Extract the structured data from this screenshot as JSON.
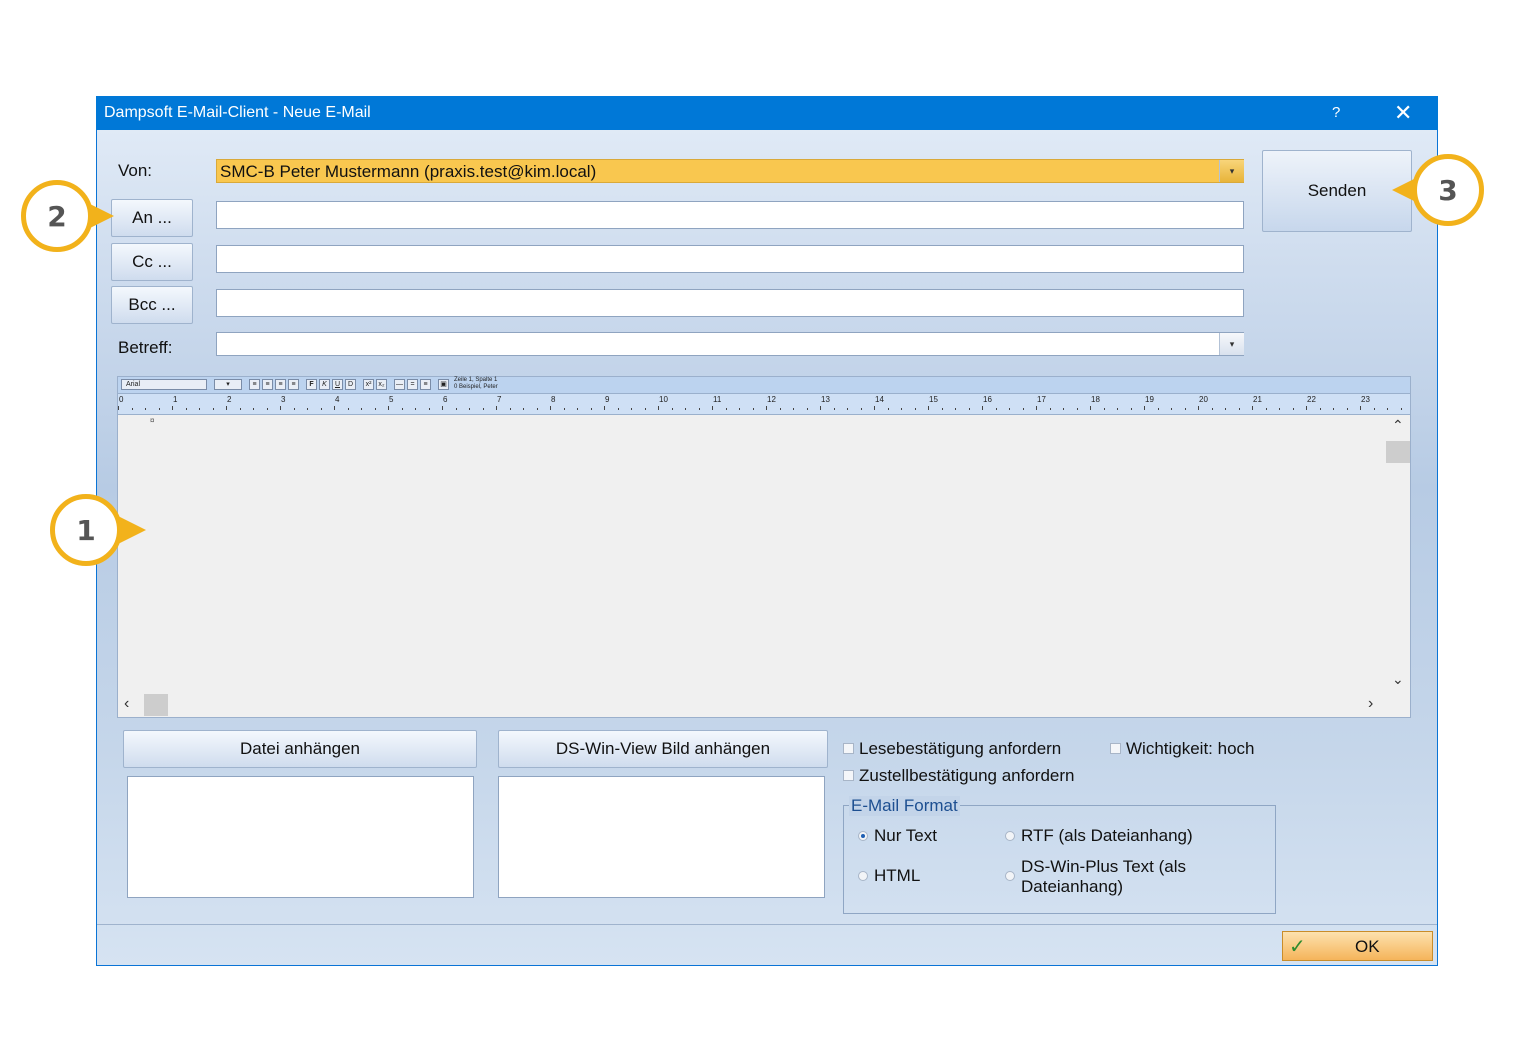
{
  "window": {
    "title": "Dampsoft E-Mail-Client - Neue E-Mail",
    "help": "?",
    "close": "✕"
  },
  "form": {
    "von_label": "Von:",
    "von_value": "SMC-B Peter Mustermann (praxis.test@kim.local)",
    "an_button": "An ...",
    "cc_button": "Cc ...",
    "bcc_button": "Bcc ...",
    "betreff_label": "Betreff:",
    "send_button": "Senden"
  },
  "editor": {
    "font_name": "Arial",
    "status_line1": "Zeile 1, Spalte 1",
    "status_line2": "0 Beispiel, Peter",
    "ruler_numbers": [
      "0",
      "1",
      "2",
      "3",
      "4",
      "5",
      "6",
      "7",
      "8",
      "9",
      "10",
      "11",
      "12",
      "13",
      "14",
      "15",
      "16",
      "17",
      "18",
      "19",
      "20",
      "21",
      "22",
      "23"
    ]
  },
  "attachments": {
    "file_button": "Datei anhängen",
    "image_button": "DS-Win-View Bild anhängen"
  },
  "options": {
    "read_receipt": "Lesebestätigung anfordern",
    "delivery_receipt": "Zustellbestätigung anfordern",
    "importance": "Wichtigkeit: hoch"
  },
  "format": {
    "group_label": "E-Mail Format",
    "nur_text": "Nur Text",
    "rtf": "RTF (als Dateianhang)",
    "html": "HTML",
    "dswin_line1": "DS-Win-Plus Text (als",
    "dswin_line2": "Dateianhang)",
    "selected": "Nur Text"
  },
  "footer": {
    "ok_button": "OK"
  },
  "callouts": [
    "1",
    "2",
    "3"
  ],
  "colors": {
    "accent": "#0078d7",
    "highlight": "#f9c74f",
    "callout": "#f2b21b"
  }
}
